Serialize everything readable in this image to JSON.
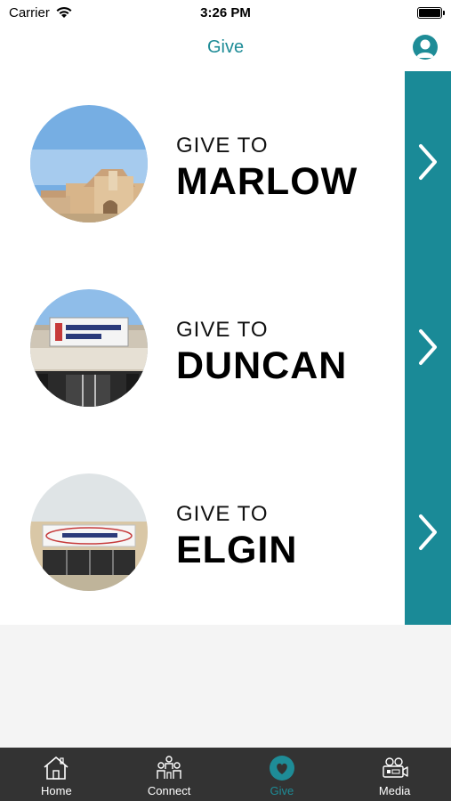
{
  "status": {
    "carrier": "Carrier",
    "time": "3:26 PM"
  },
  "nav": {
    "title": "Give",
    "profile_icon": "person-icon"
  },
  "locations": [
    {
      "prefix": "GIVE TO",
      "name": "MARLOW"
    },
    {
      "prefix": "GIVE TO",
      "name": "DUNCAN"
    },
    {
      "prefix": "GIVE TO",
      "name": "ELGIN"
    }
  ],
  "colors": {
    "accent": "#1a8a97",
    "tab_bar": "#333333"
  },
  "tabs": [
    {
      "label": "Home",
      "icon": "home-icon"
    },
    {
      "label": "Connect",
      "icon": "people-icon"
    },
    {
      "label": "Give",
      "icon": "heart-icon",
      "active": true
    },
    {
      "label": "Media",
      "icon": "video-camera-icon"
    }
  ]
}
